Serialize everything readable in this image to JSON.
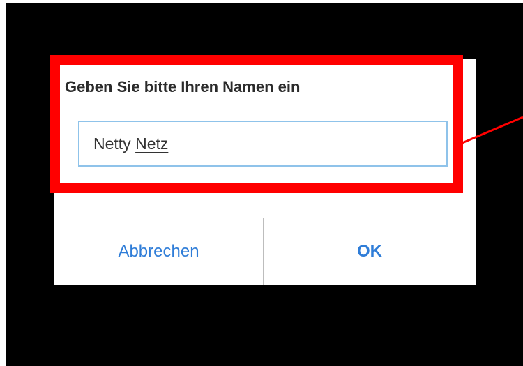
{
  "dialog": {
    "prompt": "Geben Sie bitte Ihren Namen ein",
    "name_input": {
      "first_word": "Netty",
      "suggestion_word": "Netz"
    },
    "buttons": {
      "cancel": "Abbrechen",
      "ok": "OK"
    }
  },
  "colors": {
    "screen_background": "#000000",
    "dialog_background": "#ffffff",
    "highlight": "#ff0000",
    "input_border": "#8fc3ea",
    "button_text": "#2f7dd8",
    "divider": "#bdbdbd"
  }
}
